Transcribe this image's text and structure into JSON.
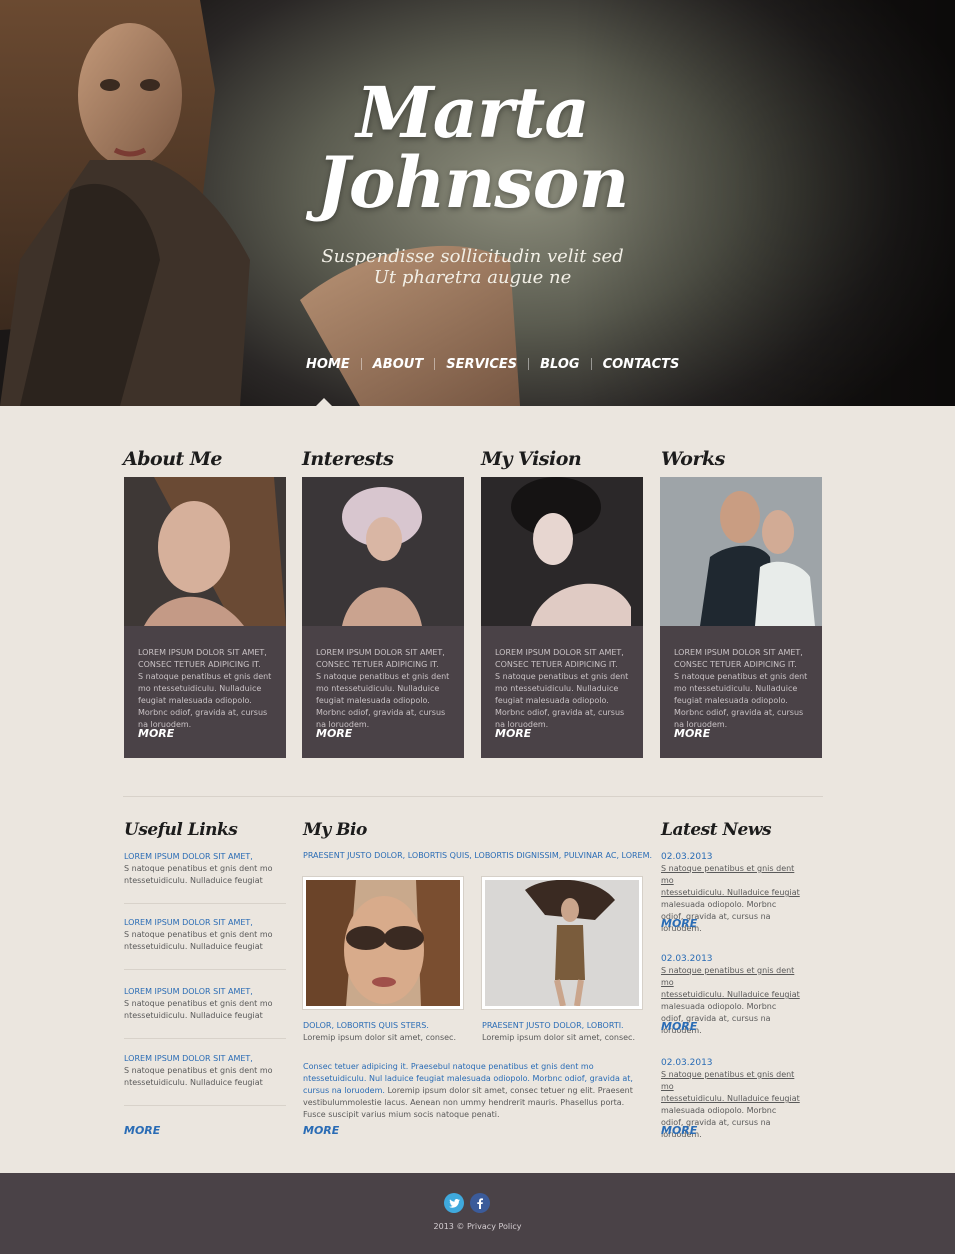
{
  "hero": {
    "title_line1": "Marta",
    "title_line2": "Johnson",
    "subtitle_line1": "Suspendisse sollicitudin velit sed",
    "subtitle_line2": "Ut pharetra augue ne"
  },
  "nav": {
    "items": [
      {
        "label": "HOME"
      },
      {
        "label": "ABOUT"
      },
      {
        "label": "SERVICES"
      },
      {
        "label": "BLOG"
      },
      {
        "label": "CONTACTS"
      }
    ],
    "active": "HOME"
  },
  "features": [
    {
      "title": "About Me",
      "caps1": "LOREM IPSUM DOLOR SIT AMET,",
      "caps2": "CONSEC TETUER ADIPICING IT.",
      "body": "S natoque penatibus et gnis dent mo ntessetuidiculu. Nulladuice feugiat malesuada odiopolo. Morbnc odiof, gravida at, cursus na loruodem.",
      "more": "MORE"
    },
    {
      "title": "Interests",
      "caps1": "LOREM IPSUM DOLOR SIT AMET,",
      "caps2": "CONSEC TETUER ADIPICING IT.",
      "body": "S natoque penatibus et gnis dent mo ntessetuidiculu. Nulladuice feugiat malesuada odiopolo. Morbnc odiof, gravida at, cursus na loruodem.",
      "more": "MORE"
    },
    {
      "title": "My Vision",
      "caps1": "LOREM IPSUM DOLOR SIT AMET,",
      "caps2": "CONSEC TETUER ADIPICING IT.",
      "body": "S natoque penatibus et gnis dent mo ntessetuidiculu. Nulladuice feugiat malesuada odiopolo. Morbnc odiof, gravida at, cursus na loruodem.",
      "more": "MORE"
    },
    {
      "title": "Works",
      "caps1": "LOREM IPSUM DOLOR SIT AMET,",
      "caps2": "CONSEC TETUER ADIPICING IT.",
      "body": "S natoque penatibus et gnis dent mo ntessetuidiculu. Nulladuice feugiat malesuada odiopolo. Morbnc odiof, gravida at, cursus na loruodem.",
      "more": "MORE"
    }
  ],
  "useful_links": {
    "title": "Useful Links",
    "items": [
      {
        "head": "LOREM IPSUM DOLOR SIT AMET,",
        "body": "S natoque penatibus et gnis dent mo ntessetuidiculu. Nulladuice feugiat"
      },
      {
        "head": "LOREM IPSUM DOLOR SIT AMET,",
        "body": "S natoque penatibus et gnis dent mo ntessetuidiculu. Nulladuice feugiat"
      },
      {
        "head": "LOREM IPSUM DOLOR SIT AMET,",
        "body": "S natoque penatibus et gnis dent mo ntessetuidiculu. Nulladuice feugiat"
      },
      {
        "head": "LOREM IPSUM DOLOR SIT AMET,",
        "body": "S natoque penatibus et gnis dent mo ntessetuidiculu. Nulladuice feugiat"
      }
    ],
    "more": "MORE"
  },
  "bio": {
    "title": "My Bio",
    "lead": "PRAESENT JUSTO DOLOR, LOBORTIS QUIS, LOBORTIS DIGNISSIM, PULVINAR AC, LOREM.",
    "captions": [
      {
        "head": "DOLOR, LOBORTIS QUIS STERS.",
        "body": "Loremip ipsum dolor sit amet, consec."
      },
      {
        "head": "PRAESENT JUSTO DOLOR, LOBORTI.",
        "body": "Loremip ipsum dolor sit amet, consec."
      }
    ],
    "para_blue": "Consec tetuer adipicing it. Praesebul natoque penatibus et gnis dent mo ntessetuidiculu. Nul laduice feugiat  malesuada odiopolo. Morbnc odiof,  gravida at, cursus na loruodem.",
    "para_grey": "Loremip ipsum dolor sit amet, consec tetuer ng elit. Praesent vestibulummolestie lacus. Aenean non ummy hendrerit mauris. Phasellus porta. Fusce suscipit varius mium socis natoque penati.",
    "more": "MORE"
  },
  "news": {
    "title": "Latest News",
    "items": [
      {
        "date": "02.03.2013",
        "u1": "S natoque penatibus et gnis dent mo",
        "u2": "ntessetuidiculu. Nulladuice feugiat",
        "body": "malesuada odiopolo. Morbnc odiof, gravida at, cursus na loruodem.",
        "more": "MORE"
      },
      {
        "date": "02.03.2013",
        "u1": "S natoque penatibus et gnis dent mo",
        "u2": "ntessetuidiculu. Nulladuice feugiat",
        "body": "malesuada odiopolo. Morbnc odiof, gravida at, cursus na loruodem.",
        "more": "MORE"
      },
      {
        "date": "02.03.2013",
        "u1": "S natoque penatibus et gnis dent mo",
        "u2": "ntessetuidiculu. Nulladuice feugiat",
        "body": "malesuada odiopolo. Morbnc odiof, gravida at, cursus na loruodem.",
        "more": "MORE"
      }
    ]
  },
  "footer": {
    "copyright": "2013 © Privacy Policy",
    "social": [
      "twitter-icon",
      "facebook-icon"
    ]
  },
  "colors": {
    "accent_blue": "#2a6cb5",
    "card_bg": "#4a4247",
    "page_bg": "#ebe6df",
    "twitter": "#3fa9dd",
    "facebook": "#3b5b9a"
  }
}
